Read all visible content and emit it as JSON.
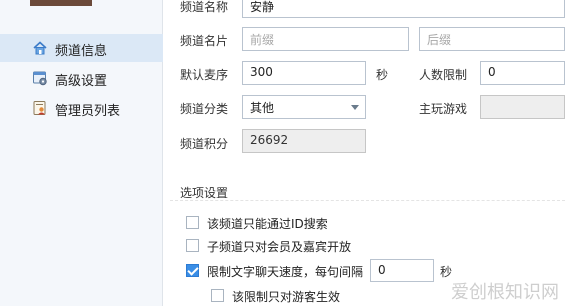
{
  "sidebar": {
    "items": [
      {
        "label": "频道信息",
        "icon": "home-icon",
        "active": true
      },
      {
        "label": "高级设置",
        "icon": "settings-icon",
        "active": false
      },
      {
        "label": "管理员列表",
        "icon": "admin-list-icon",
        "active": false
      }
    ]
  },
  "form": {
    "channel_name": {
      "label": "频道名称",
      "value": "安静"
    },
    "channel_title": {
      "label": "频道名片",
      "prefix_placeholder": "前缀",
      "suffix_placeholder": "后缀"
    },
    "default_mic": {
      "label": "默认麦序",
      "value": "300",
      "unit": "秒"
    },
    "user_limit": {
      "label": "人数限制",
      "value": "0"
    },
    "category": {
      "label": "频道分类",
      "value": "其他"
    },
    "main_game": {
      "label": "主玩游戏",
      "value": ""
    },
    "points": {
      "label": "频道积分",
      "value": "26692"
    }
  },
  "options": {
    "title": "选项设置",
    "id_search_only": {
      "label": "该频道只能通过ID搜索",
      "checked": false
    },
    "subchannel_members_only": {
      "label": "子频道只对会员及嘉宾开放",
      "checked": false
    },
    "limit_chat_speed": {
      "label": "限制文字聊天速度，每句间隔",
      "checked": true,
      "value": "0",
      "unit": "秒"
    },
    "guest_only_limit": {
      "label": "该限制只对游客生效",
      "checked": false
    }
  },
  "watermark": "爱创根知识网",
  "colors": {
    "accent": "#3a8ee6",
    "sidebar_active": "#dbe8f6",
    "sidebar_bg": "#f4f7fb"
  }
}
